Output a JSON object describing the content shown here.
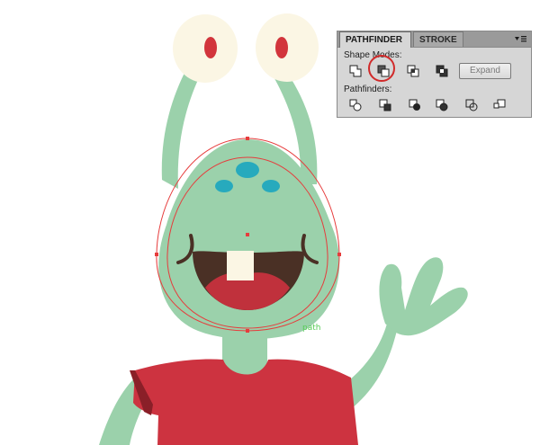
{
  "artwork": {
    "colors": {
      "body": "#9bd1ab",
      "eye": "#fbf6e4",
      "pupil": "#d2353c",
      "spots": "#27aabd",
      "mouth": "#4a3025",
      "tongue": "#c0313c",
      "tooth": "#fbf6e4",
      "shirt": "#cd3340",
      "shirt_shadow": "#8a1f28",
      "selection": "#e63c3c"
    },
    "path_label": "path"
  },
  "panel": {
    "tabs": [
      {
        "label": "PATHFINDER",
        "active": true
      },
      {
        "label": "STROKE",
        "active": false
      }
    ],
    "menu_icon": "panel-menu-icon",
    "shape_modes_label": "Shape Modes:",
    "shape_mode_buttons": [
      "unite-icon",
      "minus-front-icon",
      "intersect-icon",
      "exclude-icon"
    ],
    "expand_label": "Expand",
    "pathfinders_label": "Pathfinders:",
    "pathfinder_buttons": [
      "divide-icon",
      "trim-icon",
      "merge-icon",
      "crop-icon",
      "outline-icon",
      "minus-back-icon"
    ],
    "highlighted_button": "minus-front-icon"
  }
}
